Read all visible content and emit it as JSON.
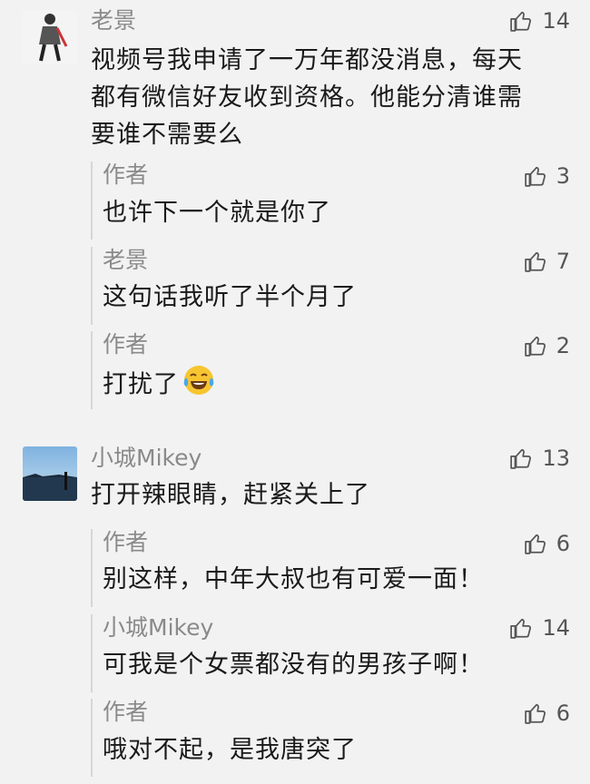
{
  "threads": [
    {
      "author": "老景",
      "likes": "14",
      "text": "视频号我申请了一万年都没消息，每天都有微信好友收到资格。他能分清谁需要谁不需要么",
      "replies": [
        {
          "author": "作者",
          "likes": "3",
          "text": "也许下一个就是你了"
        },
        {
          "author": "老景",
          "likes": "7",
          "text": "这句话我听了半个月了"
        },
        {
          "author": "作者",
          "likes": "2",
          "text": "打扰了",
          "emoji": "tears-of-joy"
        }
      ]
    },
    {
      "author": "小城Mikey",
      "likes": "13",
      "text": "打开辣眼睛，赶紧关上了",
      "replies": [
        {
          "author": "作者",
          "likes": "6",
          "text": "别这样，中年大叔也有可爱一面！"
        },
        {
          "author": "小城Mikey",
          "likes": "14",
          "text": "可我是个女票都没有的男孩子啊！"
        },
        {
          "author": "作者",
          "likes": "6",
          "text": "哦对不起，是我唐突了"
        }
      ]
    }
  ],
  "icons": {
    "like": "thumbs-up-icon"
  },
  "colors": {
    "background": "#f2f2f2",
    "name": "#8a8a8a",
    "text": "#1a1a1a",
    "reply_bar": "#d6d6d6"
  }
}
